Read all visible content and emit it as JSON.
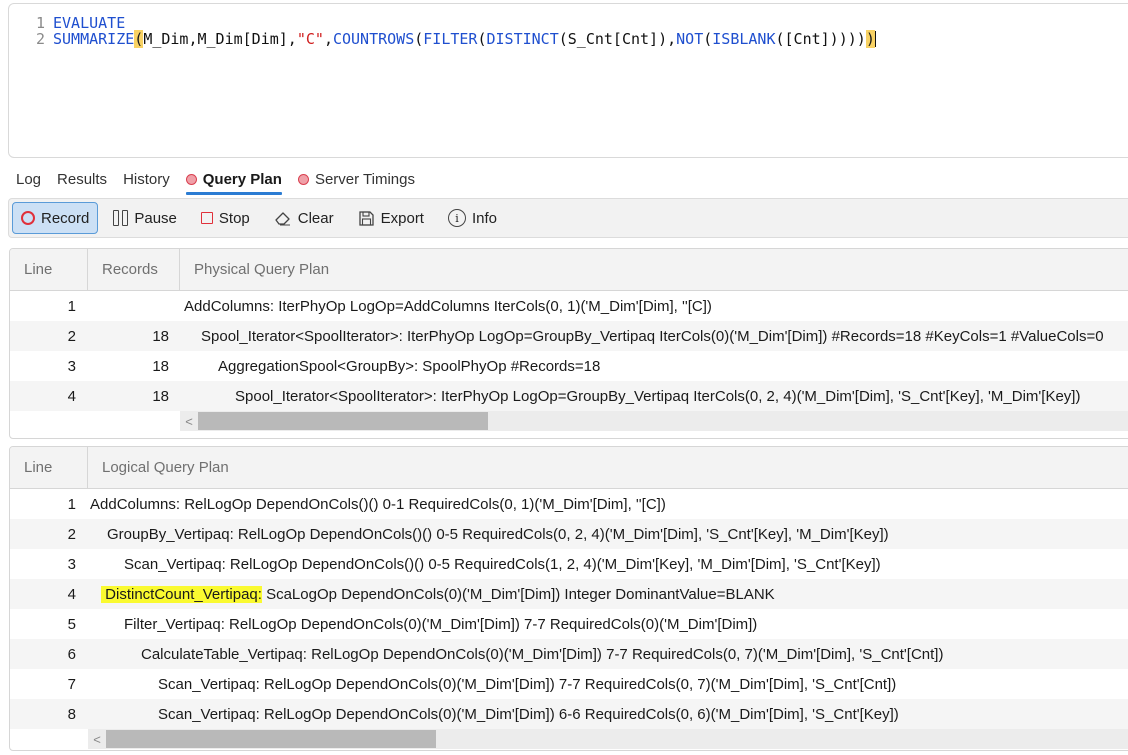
{
  "editor": {
    "lines": [
      {
        "number": "1",
        "tokens": [
          {
            "text": "EVALUATE",
            "kind": "kw"
          }
        ]
      },
      {
        "number": "2",
        "tokens": [
          {
            "text": "SUMMARIZE",
            "kind": "kw"
          },
          {
            "text": "(",
            "kind": "brace-hl"
          },
          {
            "text": "M_Dim,M_Dim[Dim],",
            "kind": "id"
          },
          {
            "text": "\"C\"",
            "kind": "str"
          },
          {
            "text": ",",
            "kind": "id"
          },
          {
            "text": "COUNTROWS",
            "kind": "kw"
          },
          {
            "text": "(",
            "kind": "id"
          },
          {
            "text": "FILTER",
            "kind": "kw"
          },
          {
            "text": "(",
            "kind": "id"
          },
          {
            "text": "DISTINCT",
            "kind": "kw"
          },
          {
            "text": "(S_Cnt[Cnt]),",
            "kind": "id"
          },
          {
            "text": "NOT",
            "kind": "kw"
          },
          {
            "text": "(",
            "kind": "id"
          },
          {
            "text": "ISBLANK",
            "kind": "kw"
          },
          {
            "text": "([Cnt]))))",
            "kind": "id"
          },
          {
            "text": ")",
            "kind": "brace-hl"
          }
        ]
      }
    ]
  },
  "tabs": [
    {
      "label": "Log",
      "dot": false,
      "active": false
    },
    {
      "label": "Results",
      "dot": false,
      "active": false
    },
    {
      "label": "History",
      "dot": false,
      "active": false
    },
    {
      "label": "Query Plan",
      "dot": true,
      "active": true
    },
    {
      "label": "Server Timings",
      "dot": true,
      "active": false
    }
  ],
  "toolbar": {
    "record_label": "Record",
    "pause_label": "Pause",
    "stop_label": "Stop",
    "clear_label": "Clear",
    "export_label": "Export",
    "info_label": "Info",
    "info_glyph": "i"
  },
  "physical_plan": {
    "headers": {
      "line": "Line",
      "records": "Records",
      "plan": "Physical Query Plan"
    },
    "rows": [
      {
        "line": "1",
        "records": "",
        "indent": 0,
        "text": "AddColumns: IterPhyOp LogOp=AddColumns IterCols(0, 1)('M_Dim'[Dim], ''[C])"
      },
      {
        "line": "2",
        "records": "18",
        "indent": 1,
        "text": "Spool_Iterator<SpoolIterator>: IterPhyOp LogOp=GroupBy_Vertipaq IterCols(0)('M_Dim'[Dim]) #Records=18 #KeyCols=1 #ValueCols=0"
      },
      {
        "line": "3",
        "records": "18",
        "indent": 2,
        "text": "AggregationSpool<GroupBy>: SpoolPhyOp #Records=18"
      },
      {
        "line": "4",
        "records": "18",
        "indent": 3,
        "text": "Spool_Iterator<SpoolIterator>: IterPhyOp LogOp=GroupBy_Vertipaq IterCols(0, 2, 4)('M_Dim'[Dim], 'S_Cnt'[Key], 'M_Dim'[Key])"
      }
    ],
    "scroll_arrow": "<"
  },
  "logical_plan": {
    "headers": {
      "line": "Line",
      "plan": "Logical Query Plan"
    },
    "rows": [
      {
        "line": "1",
        "indent": 0,
        "highlight": "",
        "text": "AddColumns: RelLogOp DependOnCols()() 0-1 RequiredCols(0, 1)('M_Dim'[Dim], ''[C])"
      },
      {
        "line": "2",
        "indent": 1,
        "highlight": "",
        "text": "GroupBy_Vertipaq: RelLogOp DependOnCols()() 0-5 RequiredCols(0, 2, 4)('M_Dim'[Dim], 'S_Cnt'[Key], 'M_Dim'[Key])"
      },
      {
        "line": "3",
        "indent": 2,
        "highlight": "",
        "text": "Scan_Vertipaq: RelLogOp DependOnCols()() 0-5 RequiredCols(1, 2, 4)('M_Dim'[Key], 'M_Dim'[Dim], 'S_Cnt'[Key])"
      },
      {
        "line": "4",
        "indent": 1,
        "highlight": " DistinctCount_Vertipaq:",
        "text": " ScaLogOp DependOnCols(0)('M_Dim'[Dim]) Integer DominantValue=BLANK"
      },
      {
        "line": "5",
        "indent": 2,
        "highlight": "",
        "text": "Filter_Vertipaq: RelLogOp DependOnCols(0)('M_Dim'[Dim]) 7-7 RequiredCols(0)('M_Dim'[Dim])"
      },
      {
        "line": "6",
        "indent": 3,
        "highlight": "",
        "text": "CalculateTable_Vertipaq: RelLogOp DependOnCols(0)('M_Dim'[Dim]) 7-7 RequiredCols(0, 7)('M_Dim'[Dim], 'S_Cnt'[Cnt])"
      },
      {
        "line": "7",
        "indent": 4,
        "highlight": "",
        "text": "Scan_Vertipaq: RelLogOp DependOnCols(0)('M_Dim'[Dim]) 7-7 RequiredCols(0, 7)('M_Dim'[Dim], 'S_Cnt'[Cnt])"
      },
      {
        "line": "8",
        "indent": 4,
        "highlight": "",
        "text": "Scan_Vertipaq: RelLogOp DependOnCols(0)('M_Dim'[Dim]) 6-6 RequiredCols(0, 6)('M_Dim'[Dim], 'S_Cnt'[Key])"
      }
    ],
    "scroll_arrow": "<"
  }
}
